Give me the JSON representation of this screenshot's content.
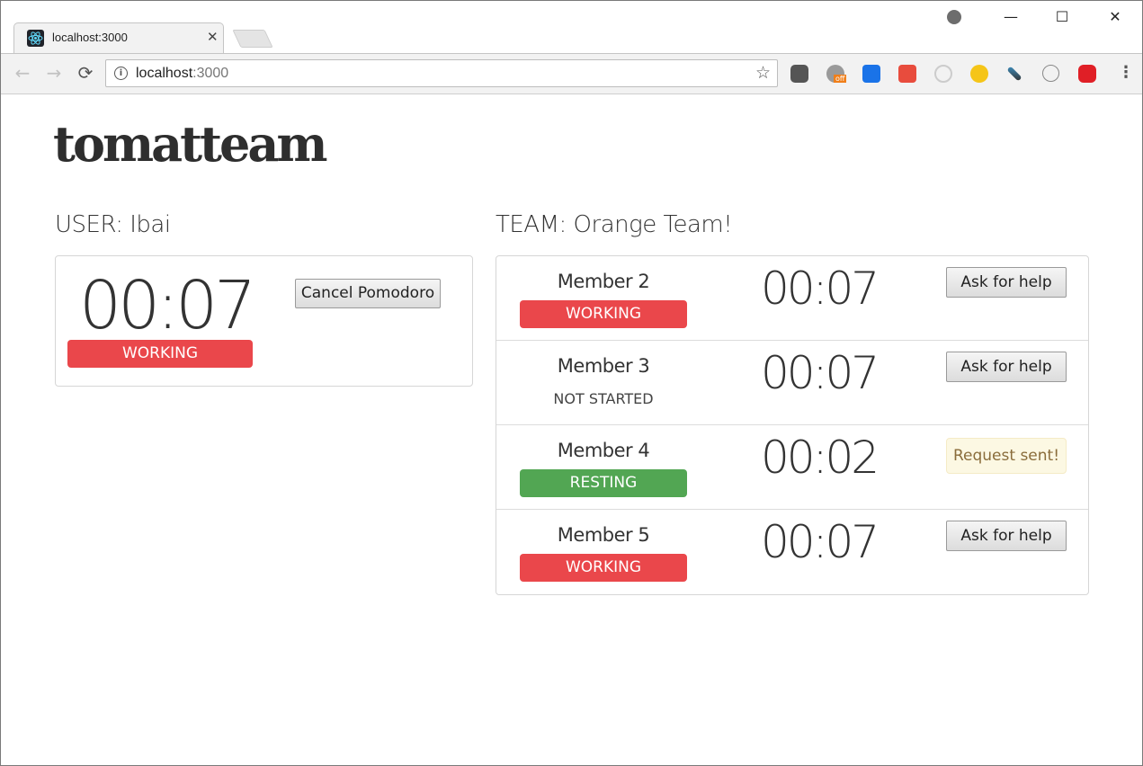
{
  "browser": {
    "tab_title": "localhost:3000",
    "tab_close": "✕",
    "url_host": "localhost",
    "url_port": ":3000",
    "window_controls": {
      "minimize": "—",
      "maximize": "☐",
      "close": "✕"
    },
    "extensions": [
      "pocket-icon",
      "fox-off-icon",
      "trello-icon",
      "paw-icon",
      "circle-icon",
      "moon-icon",
      "eyedropper-icon",
      "braces-icon",
      "stop-hand-icon"
    ],
    "extension_badge": "off"
  },
  "app": {
    "logo": "tomatteam"
  },
  "user": {
    "heading": "USER: Ibai",
    "timer": "00:07",
    "status": "WORKING",
    "status_color": "#ea474b",
    "cancel_label": "Cancel Pomodoro"
  },
  "team": {
    "heading": "TEAM: Orange Team!",
    "members": [
      {
        "name": "Member 2",
        "status": "WORKING",
        "timer": "00:07",
        "action": "Ask for help"
      },
      {
        "name": "Member 3",
        "status": "NOT STARTED",
        "timer": "00:07",
        "action": "Ask for help"
      },
      {
        "name": "Member 4",
        "status": "RESTING",
        "timer": "00:02",
        "action": "Request sent!"
      },
      {
        "name": "Member 5",
        "status": "WORKING",
        "timer": "00:07",
        "action": "Ask for help"
      }
    ]
  },
  "colors": {
    "working": "#ea474b",
    "resting": "#52a653",
    "request_sent_bg": "#fcf8e3"
  }
}
